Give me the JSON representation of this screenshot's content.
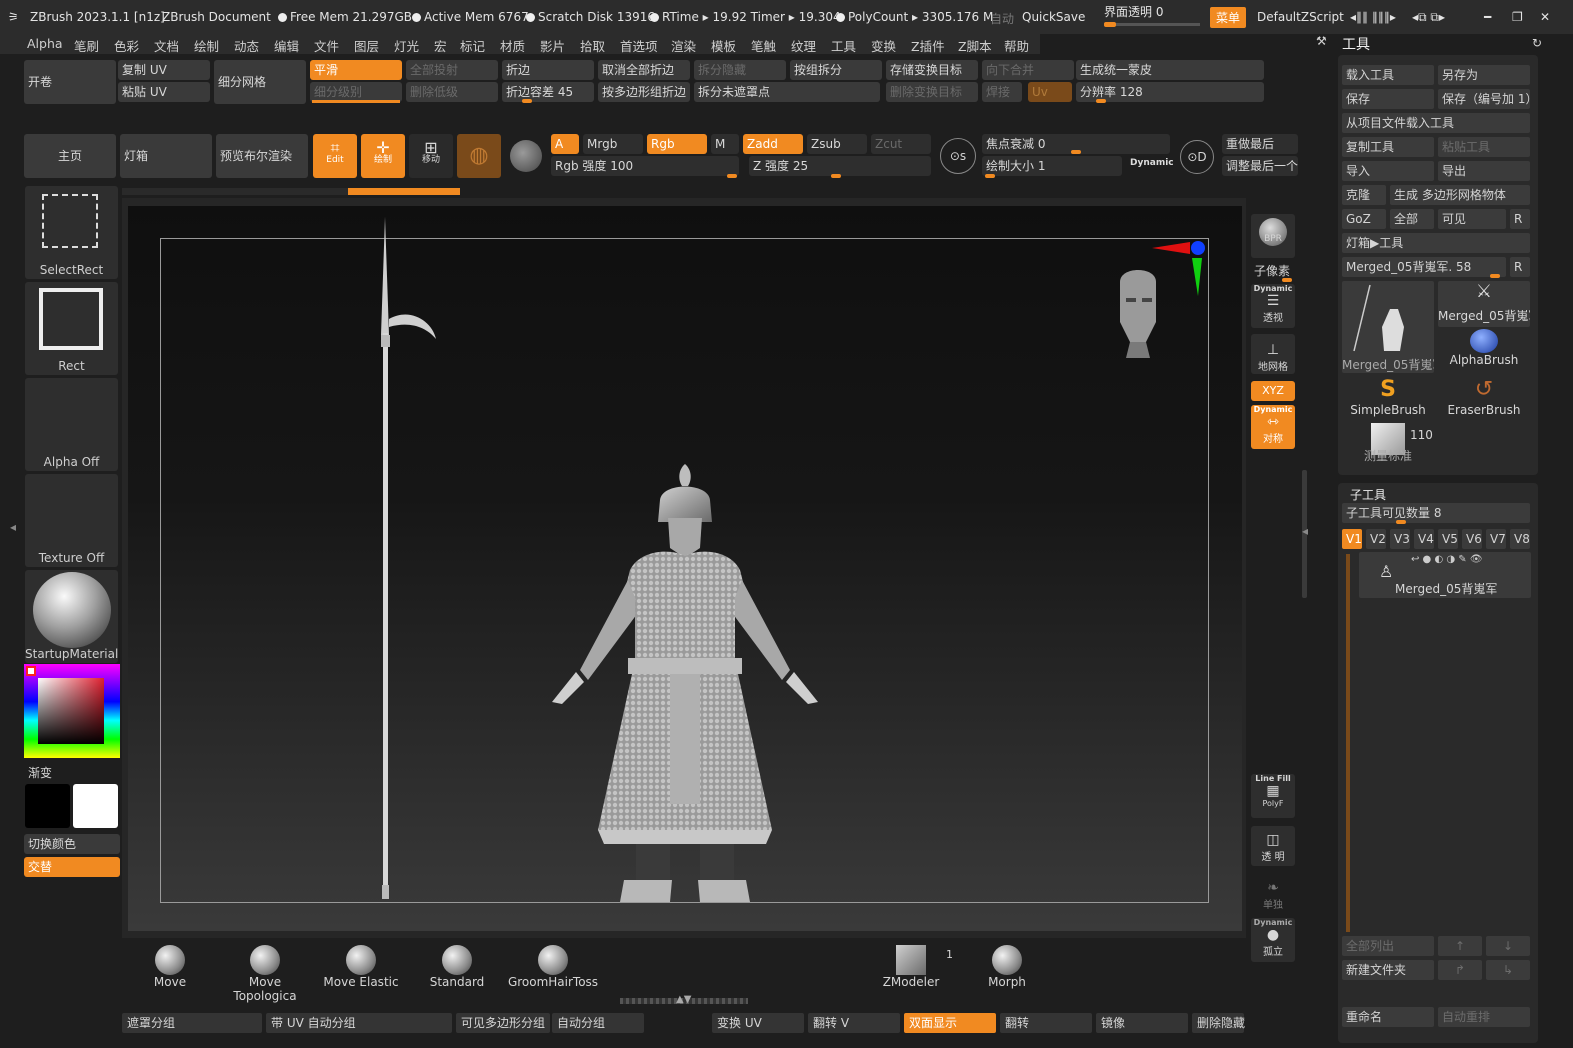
{
  "titlebar": {
    "app_title": "ZBrush 2023.1.1 [n1z]",
    "document": "ZBrush Document",
    "free_mem": "Free Mem 21.297GB",
    "active_mem": "Active Mem 6767",
    "scratch_disk": "Scratch Disk 13916",
    "rtime": "RTime ▸ 19.92 Timer ▸ 19.304",
    "polycount": "PolyCount ▸ 3305.176 M",
    "auto_label": "自动",
    "quicksave": "QuickSave",
    "transparency": "界面透明 0",
    "menu_btn": "菜单",
    "script": "DefaultZScript"
  },
  "menubar": [
    "Alpha",
    "笔刷",
    "色彩",
    "文档",
    "绘制",
    "动态",
    "编辑",
    "文件",
    "图层",
    "灯光",
    "宏",
    "标记",
    "材质",
    "影片",
    "拾取",
    "首选项",
    "渲染",
    "模板",
    "笔触",
    "纹理",
    "工具",
    "变换",
    "Z插件",
    "Z脚本",
    "帮助"
  ],
  "top_toolbar": {
    "unroll": "开卷",
    "copy_uv": "复制 UV",
    "paste_uv": "粘贴 UV",
    "subdivide_mesh": "细分网格",
    "smooth": "平滑",
    "subdiv_level": "细分级别",
    "project_all": "全部投射",
    "delete_lower": "删除低级",
    "crease": "折边",
    "crease_tolerance": "折边容差 45",
    "uncrease_all": "取消全部折边",
    "crease_by_polygroup": "按多边形组折边",
    "split_hidden": "拆分隐藏",
    "split_unmasked": "拆分未遮罩点",
    "split_by_group": "按组拆分",
    "store_morph": "存储变换目标",
    "delete_morph": "删除变换目标",
    "merge_down": "向下合并",
    "weld": "焊接",
    "uv": "Uv",
    "unified_skin": "生成统一蒙皮",
    "resolution": "分辨率 128"
  },
  "second_toolbar": {
    "home": "主页",
    "lightbox": "灯箱",
    "preview_bool": "预览布尔渲染",
    "edit": "Edit",
    "draw": "绘制",
    "move": "移动",
    "a": "A",
    "mrgb": "Mrgb",
    "rgb": "Rgb",
    "m": "M",
    "zadd": "Zadd",
    "zsub": "Zsub",
    "zcut": "Zcut",
    "rgb_intensity": "Rgb 强度 100",
    "z_intensity": "Z 强度 25",
    "focal_shift": "焦点衰减 0",
    "draw_size": "绘制大小 1",
    "dynamic": "Dynamic",
    "redo_last": "重做最后",
    "adjust_last": "调整最后一个"
  },
  "left_shelf": {
    "select_rect": "SelectRect",
    "rect": "Rect",
    "alpha_off": "Alpha Off",
    "texture_off": "Texture Off",
    "material": "StartupMaterial",
    "gradient": "渐变",
    "switch_color": "切换颜色",
    "alternate": "交替"
  },
  "right_viewtools": {
    "bpr": "BPR",
    "subpixel": "子像素",
    "dynamic1": "Dynamic",
    "persp": "透视",
    "floor": "地网格",
    "xyz": "XYZ",
    "dynamic2": "Dynamic",
    "symmetry": "对称",
    "line_fill": "Line Fill",
    "polyf": "PolyF",
    "transp": "透 明",
    "solo": "单独",
    "dynamic3": "Dynamic",
    "solo2": "孤立"
  },
  "tool_panel": {
    "title": "工具",
    "load_tool": "载入工具",
    "save_as": "另存为",
    "save": "保存",
    "save_inc": "保存（编号加 1）",
    "load_from_project": "从项目文件载入工具",
    "copy_tool": "复制工具",
    "paste_tool": "粘贴工具",
    "import": "导入",
    "export": "导出",
    "clone": "克隆",
    "make_polymesh": "生成 多边形网格物体",
    "goz": "GoZ",
    "all": "全部",
    "visible": "可见",
    "r": "R",
    "lightbox_tools": "灯箱▶工具",
    "current_tool": "Merged_05背嵬军. 58",
    "thumbs": [
      {
        "label": "Merged_05背嵬军"
      },
      {
        "label": "Merged_05背嵬军"
      },
      {
        "label": "AlphaBrush"
      },
      {
        "label": "SimpleBrush"
      },
      {
        "label": "EraserBrush"
      },
      {
        "label": "测量标准"
      }
    ],
    "cube_count": "110"
  },
  "subtool_panel": {
    "title": "子工具",
    "visible_count": "子工具可见数量 8",
    "versions": [
      "V1",
      "V2",
      "V3",
      "V4",
      "V5",
      "V6",
      "V7",
      "V8"
    ],
    "item_name": "Merged_05背嵬军",
    "list_all": "全部列出",
    "new_folder": "新建文件夹",
    "rename": "重命名",
    "auto_reorder": "自动重排"
  },
  "bottom_brushes": [
    "Move",
    "Move Topologica",
    "Move Elastic",
    "Standard",
    "GroomHairToss",
    "ZModeler",
    "Morph"
  ],
  "zmodeler_count": "1",
  "bottom_bar": {
    "mask_group": "遮罩分组",
    "uv_autogroup": "带 UV 自动分组",
    "visible_polygroup": "可见多边形分组",
    "autogroup": "自动分组",
    "transform_uv": "变换 UV",
    "flip_v": "翻转 V",
    "double_sided": "双面显示",
    "flip": "翻转",
    "mirror": "镜像",
    "delete_hidden": "删除隐藏"
  },
  "colors": {
    "accent": "#f18a21",
    "panel": "#2a2a2a",
    "background": "#1e1e1e"
  }
}
